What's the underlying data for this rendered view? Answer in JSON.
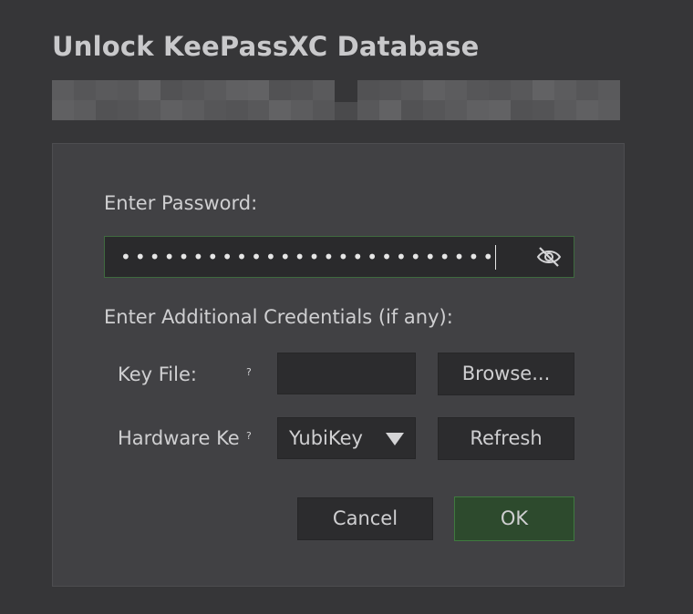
{
  "dialog": {
    "title": "Unlock KeePassXC Database"
  },
  "form": {
    "password_label": "Enter Password:",
    "password_value": "••••••••••••••••••••••••••",
    "additional_label": "Enter Additional Credentials (if any):",
    "key_file_label": "Key File:",
    "key_file_help": "?",
    "browse_label": "Browse...",
    "hardware_key_label": "Hardware Key:",
    "hardware_key_help": "?",
    "hardware_key_selected": "YubiKey",
    "refresh_label": "Refresh"
  },
  "buttons": {
    "cancel_label": "Cancel",
    "ok_label": "OK"
  },
  "colors": {
    "background": "#363638",
    "panel": "#414144",
    "ok_button": "#2d4a2d",
    "focus_border": "#3f6a3f"
  },
  "icons": {
    "password_visibility": "eye-off-icon",
    "combo": "chevron-down-icon"
  }
}
